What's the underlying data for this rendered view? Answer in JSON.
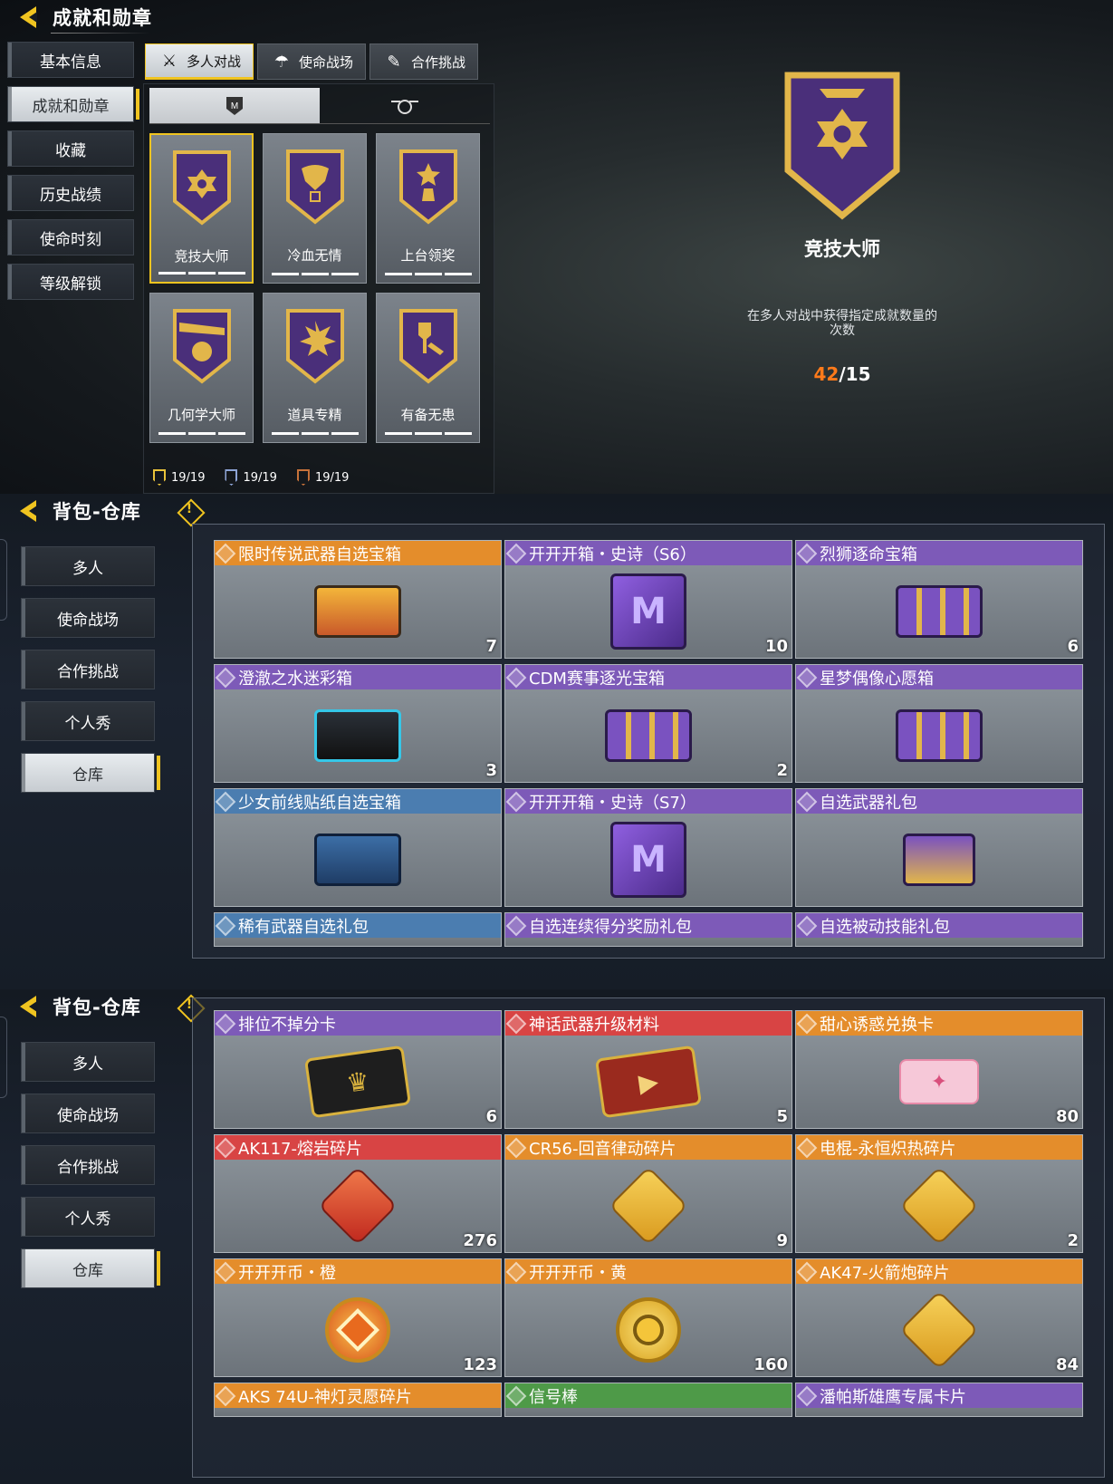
{
  "panel1": {
    "title": "成就和勋章",
    "sidebar": [
      "基本信息",
      "成就和勋章",
      "收藏",
      "历史战绩",
      "使命时刻",
      "等级解锁"
    ],
    "active_sidebar": 1,
    "tabs": [
      {
        "label": "多人对战",
        "icon": "gear-crossed-icon"
      },
      {
        "label": "使命战场",
        "icon": "parachute-icon"
      },
      {
        "label": "合作挑战",
        "icon": "weapon-icon"
      }
    ],
    "medals": [
      {
        "name": "竞技大师",
        "icon": "cross-medal-icon"
      },
      {
        "name": "冷血无情",
        "icon": "dragon-icon"
      },
      {
        "name": "上台领奖",
        "icon": "star-trophy-icon"
      },
      {
        "name": "几何学大师",
        "icon": "grenade-boom-icon"
      },
      {
        "name": "道具专精",
        "icon": "explosion-icon"
      },
      {
        "name": "有备无患",
        "icon": "shovel-icon"
      }
    ],
    "counts": [
      {
        "label": "19/19",
        "color": "#e8c23a"
      },
      {
        "label": "19/19",
        "color": "#8ea4d6"
      },
      {
        "label": "19/19",
        "color": "#c7723a"
      }
    ],
    "detail": {
      "title": "竞技大师",
      "description": "在多人对战中获得指定成就数量的次数",
      "progress_current": "42",
      "progress_total": "/15"
    }
  },
  "panel2": {
    "title": "背包-仓库",
    "sidebar": [
      "多人",
      "使命战场",
      "合作挑战",
      "个人秀",
      "仓库"
    ],
    "active_sidebar": 4,
    "items": [
      {
        "name": "限时传说武器自选宝箱",
        "count": "7",
        "quality": "orange",
        "icon": "gold-chest-icon"
      },
      {
        "name": "开开开箱・史诗（S6）",
        "count": "10",
        "quality": "purple",
        "icon": "purple-cube-icon"
      },
      {
        "name": "烈狮逐命宝箱",
        "count": "6",
        "quality": "purple",
        "icon": "purple-crate-icon"
      },
      {
        "name": "澄澈之水迷彩箱",
        "count": "3",
        "quality": "purple",
        "icon": "blue-black-chest-icon"
      },
      {
        "name": "CDM赛事逐光宝箱",
        "count": "2",
        "quality": "purple",
        "icon": "purple-crate-icon"
      },
      {
        "name": "星梦偶像心愿箱",
        "count": "",
        "quality": "purple",
        "icon": "purple-crate-icon"
      },
      {
        "name": "少女前线贴纸自选宝箱",
        "count": "",
        "quality": "blue",
        "icon": "blue-chest-icon"
      },
      {
        "name": "开开开箱・史诗（S7）",
        "count": "",
        "quality": "purple",
        "icon": "purple-cube-icon"
      },
      {
        "name": "自选武器礼包",
        "count": "",
        "quality": "purple",
        "icon": "weapon-gift-icon"
      },
      {
        "name": "稀有武器自选礼包",
        "count": "",
        "quality": "blue",
        "icon": "",
        "partial": true
      },
      {
        "name": "自选连续得分奖励礼包",
        "count": "",
        "quality": "purple",
        "icon": "",
        "partial": true
      },
      {
        "name": "自选被动技能礼包",
        "count": "",
        "quality": "purple",
        "icon": "",
        "partial": true
      }
    ]
  },
  "panel3": {
    "title": "背包-仓库",
    "sidebar": [
      "多人",
      "使命战场",
      "合作挑战",
      "个人秀",
      "仓库"
    ],
    "active_sidebar": 4,
    "items": [
      {
        "name": "排位不掉分卡",
        "count": "6",
        "quality": "purple",
        "icon": "rank-card-icon"
      },
      {
        "name": "神话武器升级材料",
        "count": "5",
        "quality": "red",
        "icon": "red-card-icon"
      },
      {
        "name": "甜心诱惑兑换卡",
        "count": "80",
        "quality": "orange",
        "icon": "pink-ticket-icon"
      },
      {
        "name": "AK117-熔岩碎片",
        "count": "276",
        "quality": "red",
        "icon": "red-puzzle-icon"
      },
      {
        "name": "CR56-回音律动碎片",
        "count": "9",
        "quality": "orange",
        "icon": "gold-puzzle-icon"
      },
      {
        "name": "电棍-永恒炽热碎片",
        "count": "2",
        "quality": "orange",
        "icon": "gold-puzzle-icon"
      },
      {
        "name": "开开开币・橙",
        "count": "123",
        "quality": "orange",
        "icon": "orange-coin-icon"
      },
      {
        "name": "开开开币・黄",
        "count": "160",
        "quality": "orange",
        "icon": "yellow-coin-icon"
      },
      {
        "name": "AK47-火箭炮碎片",
        "count": "84",
        "quality": "orange",
        "icon": "gold-puzzle-icon"
      },
      {
        "name": "AKS 74U-神灯灵愿碎片",
        "count": "",
        "quality": "orange",
        "icon": "",
        "partial": true
      },
      {
        "name": "信号棒",
        "count": "",
        "quality": "green",
        "icon": "",
        "partial": true
      },
      {
        "name": "潘帕斯雄鹰专属卡片",
        "count": "",
        "quality": "purple",
        "icon": "",
        "partial": true
      }
    ]
  }
}
